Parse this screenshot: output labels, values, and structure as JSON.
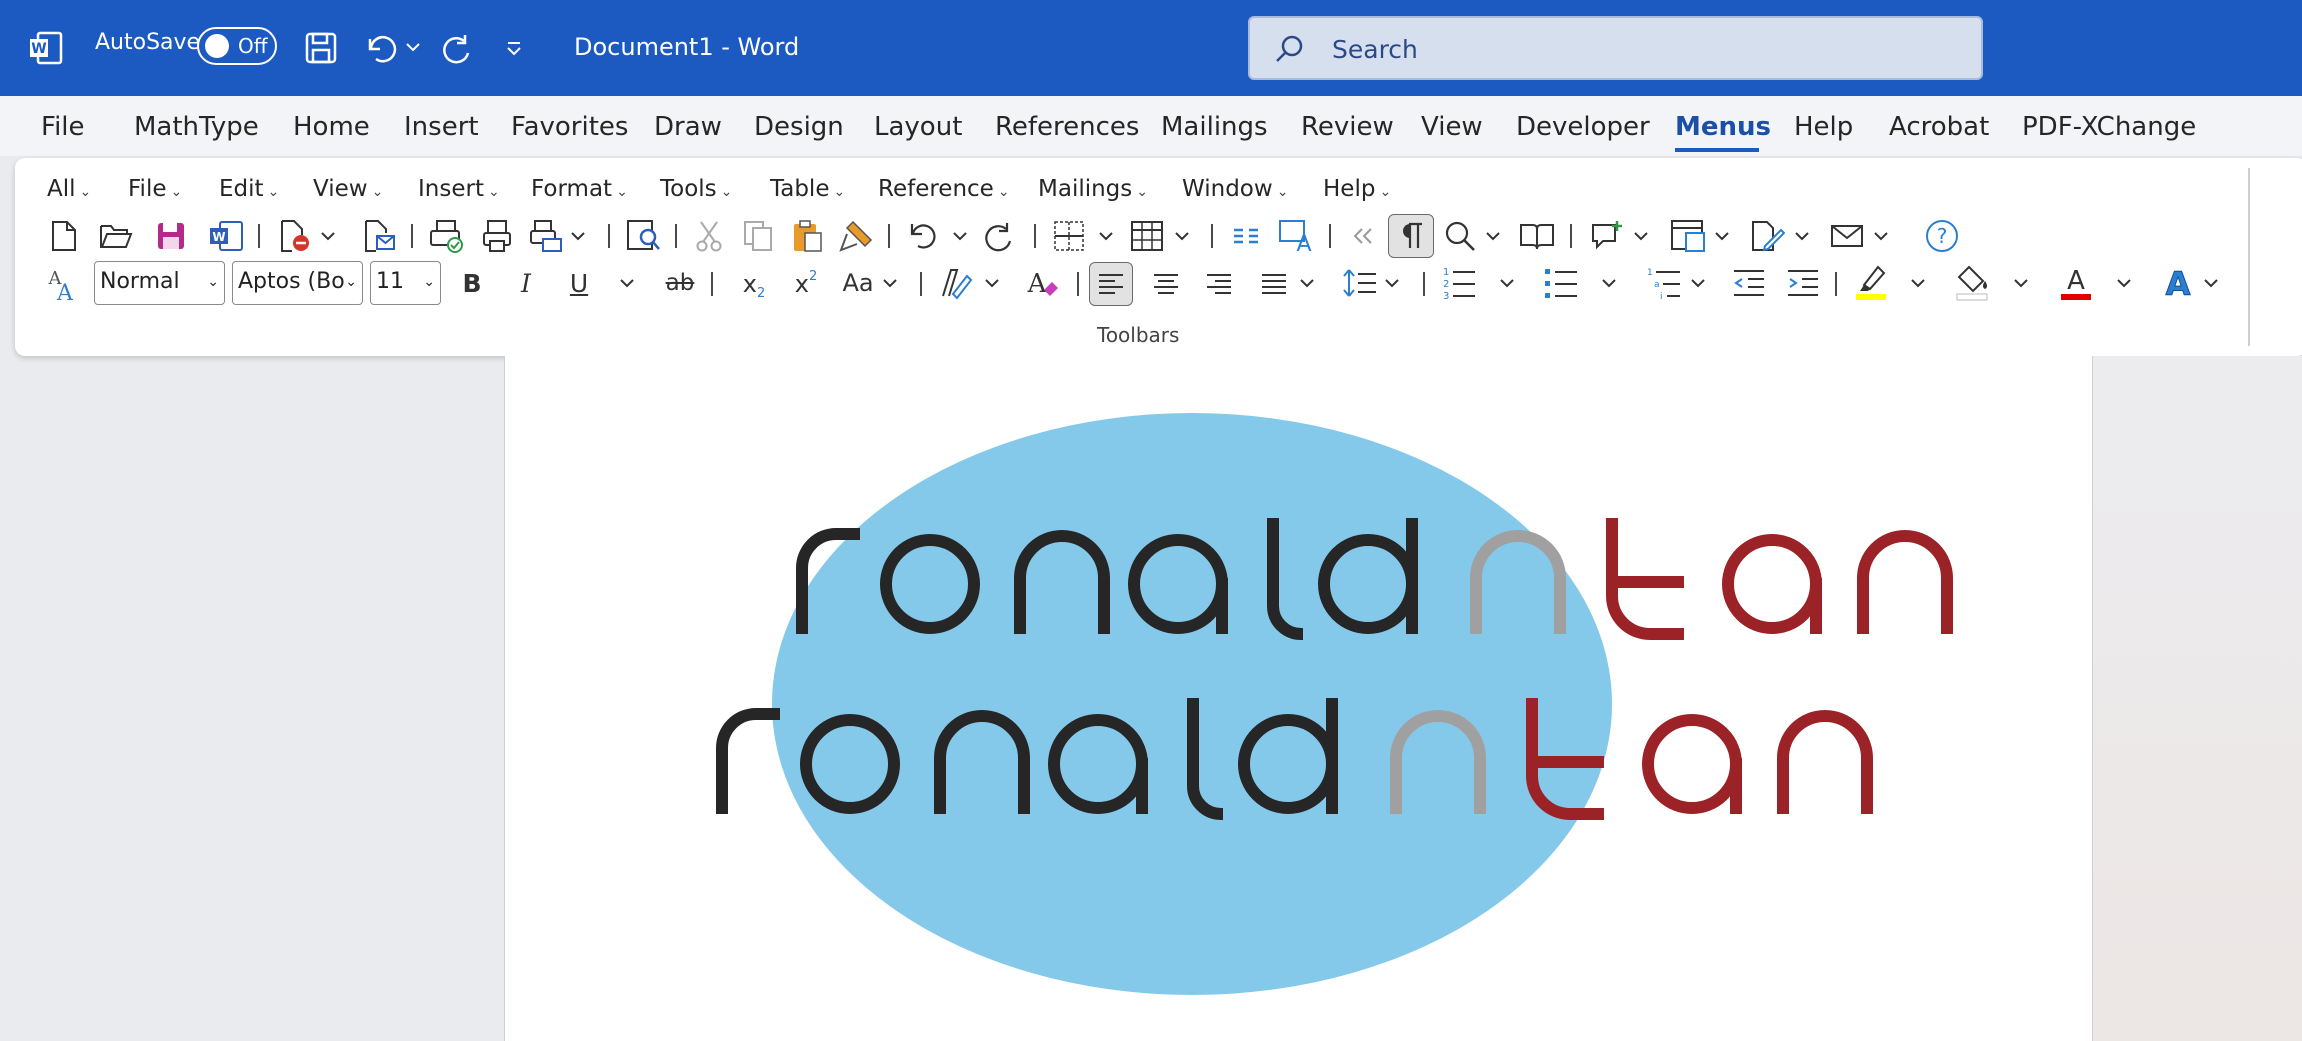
{
  "titlebar": {
    "autosave_label": "AutoSave",
    "autosave_state": "Off",
    "document_title": "Document1  -  Word",
    "search_placeholder": "Search"
  },
  "menubar": {
    "items": [
      "File",
      "MathType",
      "Home",
      "Insert",
      "Favorites",
      "Draw",
      "Design",
      "Layout",
      "References",
      "Mailings",
      "Review",
      "View",
      "Developer",
      "Menus",
      "Help",
      "Acrobat",
      "PDF-XChange"
    ],
    "active": "Menus"
  },
  "classic_menu": {
    "items": [
      "All",
      "File",
      "Edit",
      "View",
      "Insert",
      "Format",
      "Tools",
      "Table",
      "Reference",
      "Mailings",
      "Window",
      "Help"
    ]
  },
  "format_toolbar": {
    "style": "Normal",
    "font": "Aptos (Bo",
    "size": "11",
    "bold": "B",
    "italic": "I",
    "underline": "U",
    "strike": "ab",
    "subscript": "x",
    "subscript_mark": "2",
    "superscript": "x",
    "superscript_mark": "2",
    "change_case": "Aa",
    "font_color_letter": "A",
    "text_effects_letter": "A",
    "style_icon_letter": "A"
  },
  "ribbon_group_label": "Toolbars",
  "document": {
    "line1": "ronaldntan",
    "line2": "ronaldntan"
  },
  "colors": {
    "titlebar": "#1c5ac2",
    "ellipse": "#84c9ea",
    "logo_dark": "#262626",
    "logo_gray": "#a0a0a0",
    "logo_red": "#9b2226",
    "highlight": "#ffff00",
    "font_color": "#e00000"
  }
}
